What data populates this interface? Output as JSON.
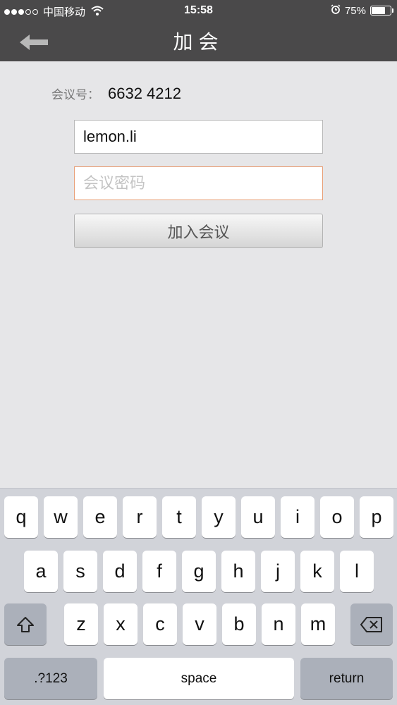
{
  "status": {
    "carrier": "中国移动",
    "time": "15:58",
    "battery_pct": 75,
    "battery_label": "75%"
  },
  "nav": {
    "title": "加会"
  },
  "form": {
    "meeting_label": "会议号：",
    "meeting_number": "6632 4212",
    "username_value": "lemon.li",
    "password_placeholder": "会议密码",
    "join_label": "加入会议"
  },
  "keyboard": {
    "row1": [
      "q",
      "w",
      "e",
      "r",
      "t",
      "y",
      "u",
      "i",
      "o",
      "p"
    ],
    "row2": [
      "a",
      "s",
      "d",
      "f",
      "g",
      "h",
      "j",
      "k",
      "l"
    ],
    "row3": [
      "z",
      "x",
      "c",
      "v",
      "b",
      "n",
      "m"
    ],
    "numbers_label": ".?123",
    "space_label": "space",
    "return_label": "return"
  },
  "colors": {
    "topbar": "#4a494a",
    "background": "#e6e6e8",
    "keyboard": "#d1d3d9",
    "focus_border": "#e8a078"
  }
}
